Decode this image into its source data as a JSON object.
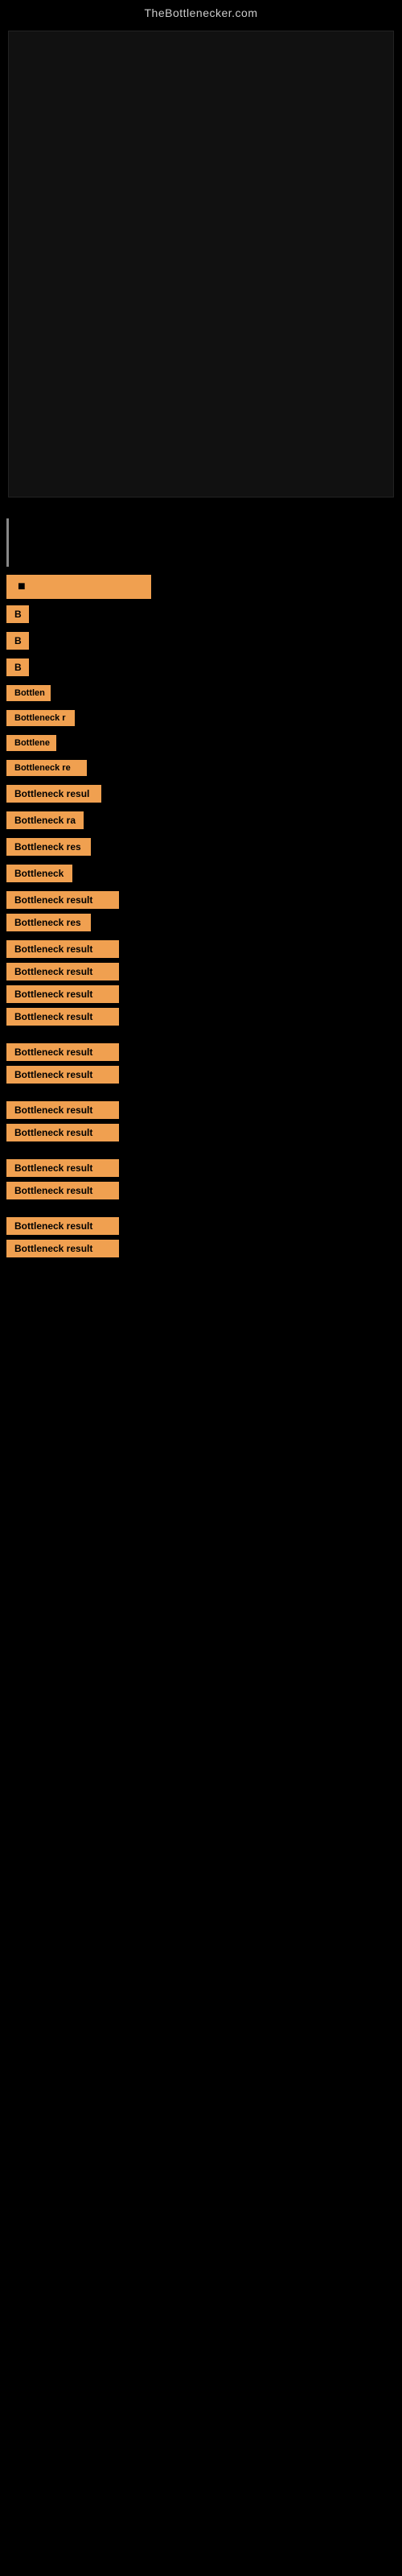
{
  "site": {
    "title": "TheBottlenecker.com"
  },
  "labels": [
    {
      "text": "B",
      "size": "tiny"
    },
    {
      "text": "B",
      "size": "tiny"
    },
    {
      "text": "B",
      "size": "tiny"
    },
    {
      "text": "Bottlen",
      "size": "small2"
    },
    {
      "text": "Bottleneck r",
      "size": "med1"
    },
    {
      "text": "Bottlene",
      "size": "small3"
    },
    {
      "text": "Bottleneck re",
      "size": "med2"
    },
    {
      "text": "Bottleneck resul",
      "size": "med3"
    },
    {
      "text": "Bottleneck ra",
      "size": "med4"
    },
    {
      "text": "Bottleneck res",
      "size": "med5"
    },
    {
      "text": "Bottleneck",
      "size": "med6"
    },
    {
      "text": "Bottleneck result",
      "size": "full"
    },
    {
      "text": "Bottleneck res",
      "size": "med5"
    },
    {
      "text": "Bottleneck result",
      "size": "full"
    },
    {
      "text": "Bottleneck result",
      "size": "full"
    },
    {
      "text": "Bottleneck result",
      "size": "full"
    },
    {
      "text": "Bottleneck result",
      "size": "full"
    },
    {
      "text": "Bottleneck result",
      "size": "full"
    },
    {
      "text": "Bottleneck result",
      "size": "full"
    },
    {
      "text": "Bottleneck result",
      "size": "full"
    },
    {
      "text": "Bottleneck result",
      "size": "full"
    },
    {
      "text": "Bottleneck result",
      "size": "full"
    },
    {
      "text": "Bottleneck result",
      "size": "full"
    },
    {
      "text": "Bottleneck result",
      "size": "full"
    },
    {
      "text": "Bottleneck result",
      "size": "full"
    }
  ]
}
